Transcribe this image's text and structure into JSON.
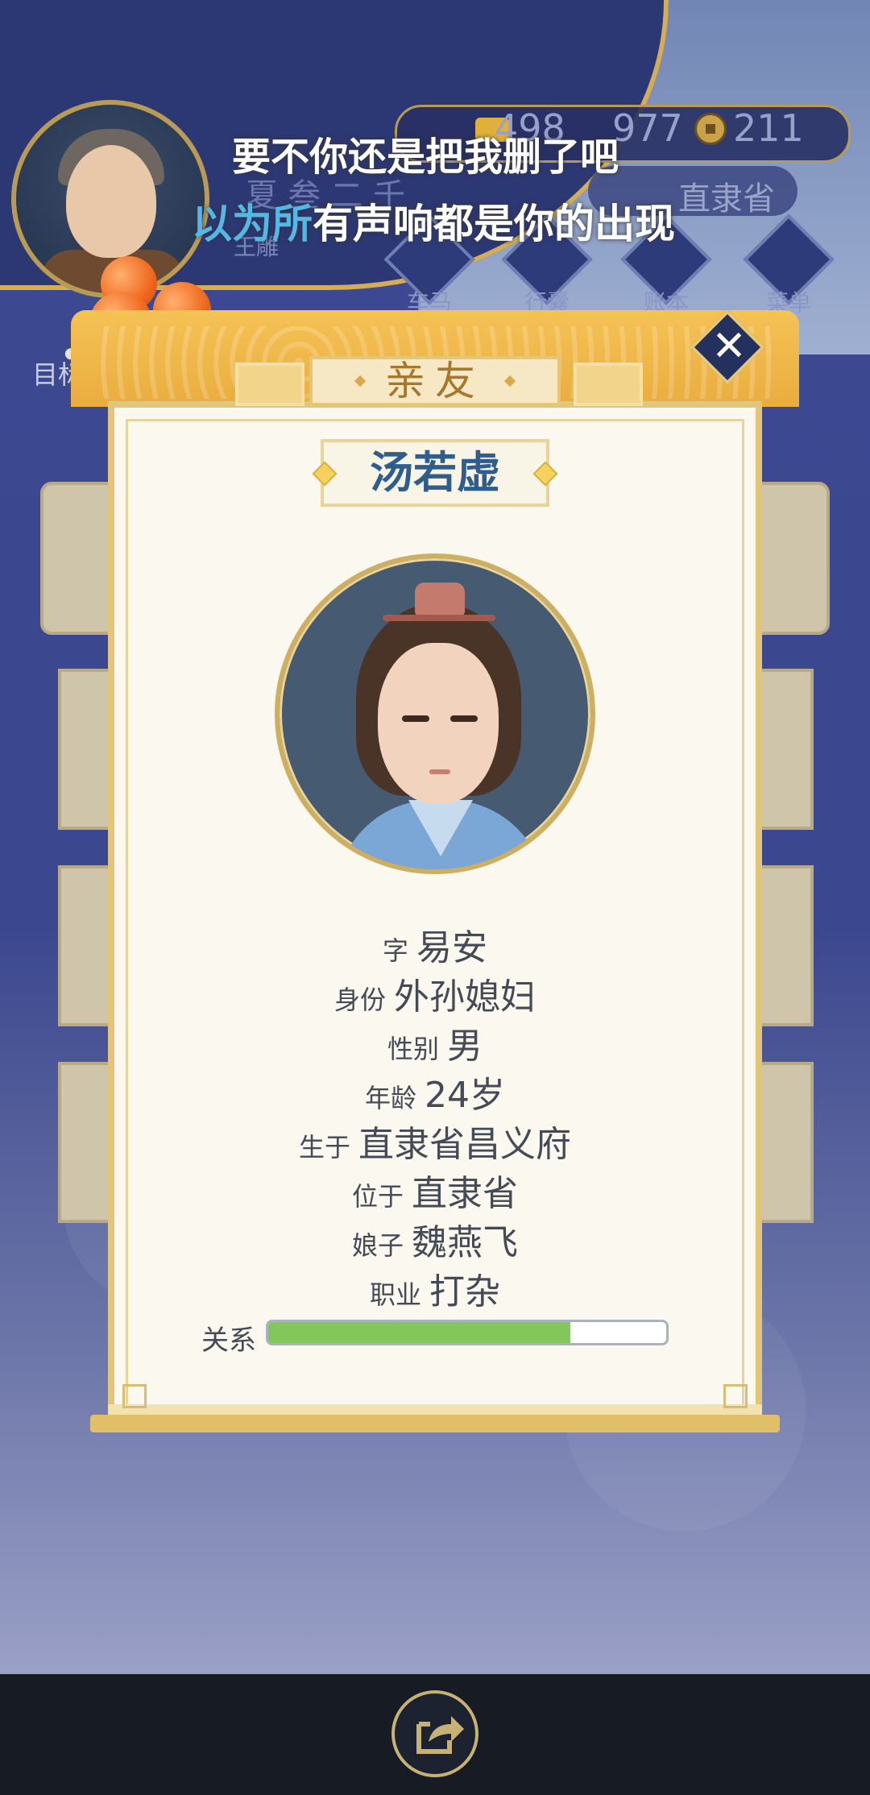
{
  "resources": {
    "gold": "498",
    "silver": "977",
    "coins": "211"
  },
  "location": "直隶省",
  "player": {
    "season": "夏 叁 二 千",
    "name": "王雕"
  },
  "nav": [
    {
      "label": "车马",
      "icon": "carriage-icon"
    },
    {
      "label": "行囊",
      "icon": "bag-icon"
    },
    {
      "label": "账本",
      "icon": "ledger-icon"
    },
    {
      "label": "菜单",
      "icon": "menu-dots-icon"
    }
  ],
  "goal_label": "目标",
  "lyrics": {
    "line1": "要不你还是把我删了吧",
    "line2_highlight": "以为所",
    "line2_rest": "有声响都是你的出现"
  },
  "dialog": {
    "title": "亲友",
    "name": "汤若虚",
    "fields": [
      {
        "key": "字",
        "value": "易安"
      },
      {
        "key": "身份",
        "value": "外孙媳妇"
      },
      {
        "key": "性别",
        "value": "男"
      },
      {
        "key": "年龄",
        "value": "24岁"
      },
      {
        "key": "生于",
        "value": "直隶省昌义府"
      },
      {
        "key": "位于",
        "value": "直隶省"
      },
      {
        "key": "娘子",
        "value": "魏燕飞"
      },
      {
        "key": "职业",
        "value": "打杂"
      }
    ],
    "relation_label": "关系",
    "relation_fraction": 0.76,
    "close_symbol": "✕"
  },
  "colors": {
    "accent_gold": "#e9ad3e",
    "name_blue": "#2f5d8c",
    "relation_green": "#83c65a"
  }
}
